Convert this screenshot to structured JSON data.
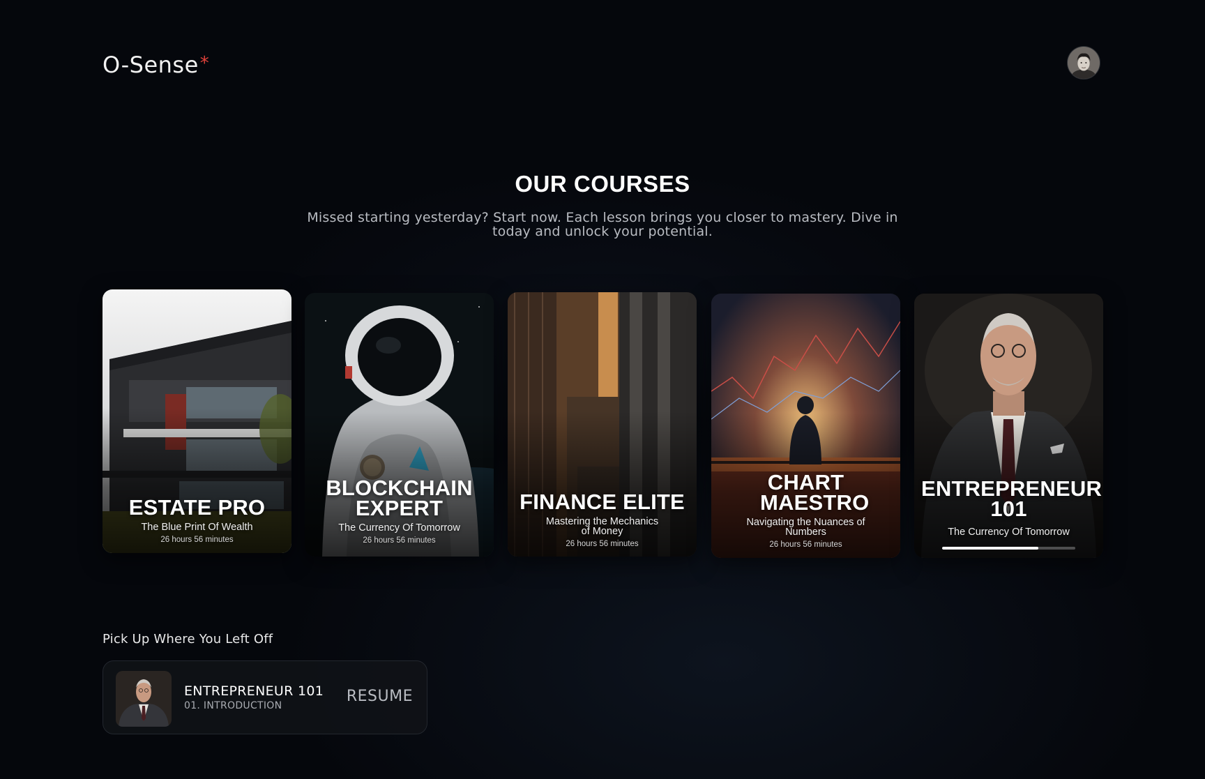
{
  "brand": {
    "name": "O-Sense",
    "mark": "*",
    "accent": "#e0413a"
  },
  "header": {
    "avatar_icon": "user-avatar-icon"
  },
  "courses_section": {
    "title": "OUR COURSES",
    "subtitle": "Missed starting yesterday? Start now. Each lesson brings you closer to mastery. Dive in today and unlock your potential."
  },
  "courses": [
    {
      "title": "ESTATE PRO",
      "tagline": "The Blue Print Of Wealth",
      "duration": "26 hours 56 minutes"
    },
    {
      "title": "BLOCKCHAIN EXPERT",
      "tagline": "The Currency Of Tomorrow",
      "duration": "26 hours 56 minutes"
    },
    {
      "title": "FINANCE ELITE",
      "tagline": "Mastering the Mechanics of Money",
      "duration": "26 hours 56 minutes"
    },
    {
      "title": "CHART MAESTRO",
      "tagline": "Navigating the Nuances of Numbers",
      "duration": "26 hours 56 minutes"
    },
    {
      "title": "ENTREPRENEUR 101",
      "tagline": "The Currency Of Tomorrow",
      "progress": 0.72
    }
  ],
  "continue_section": {
    "label": "Pick Up Where You Left Off",
    "course_title": "ENTREPRENEUR 101",
    "lesson": "01. INTRODUCTION",
    "resume_label": "RESUME"
  }
}
